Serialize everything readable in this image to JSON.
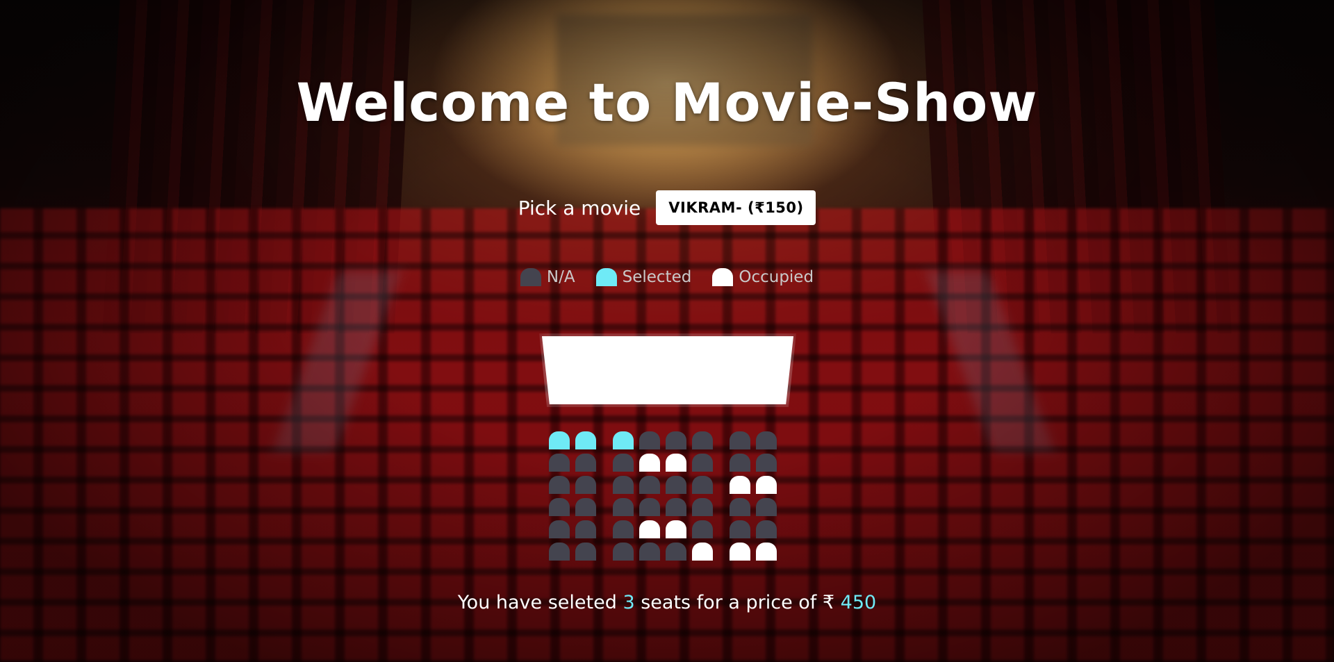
{
  "header": {
    "title": "Welcome to Movie-Show"
  },
  "picker": {
    "label": "Pick a movie",
    "selected_movie": "VIKRAM- (₹150)"
  },
  "legend": {
    "items": [
      {
        "label": "N/A",
        "state": "na"
      },
      {
        "label": "Selected",
        "state": "selected"
      },
      {
        "label": "Occupied",
        "state": "occupied"
      }
    ]
  },
  "seats": {
    "rows": [
      [
        "selected",
        "selected",
        "selected",
        "na",
        "na",
        "na",
        "na",
        "na"
      ],
      [
        "na",
        "na",
        "na",
        "occupied",
        "occupied",
        "na",
        "na",
        "na"
      ],
      [
        "na",
        "na",
        "na",
        "na",
        "na",
        "na",
        "occupied",
        "occupied"
      ],
      [
        "na",
        "na",
        "na",
        "na",
        "na",
        "na",
        "na",
        "na"
      ],
      [
        "na",
        "na",
        "na",
        "occupied",
        "occupied",
        "na",
        "na",
        "na"
      ],
      [
        "na",
        "na",
        "na",
        "na",
        "na",
        "occupied",
        "occupied",
        "occupied"
      ]
    ]
  },
  "summary": {
    "prefix": "You have seleted",
    "count": "3",
    "middle": "seats for a price of ₹",
    "price": "450"
  },
  "colors": {
    "selected": "#6feaf6",
    "occupied": "#ffffff",
    "na": "#44444f"
  }
}
